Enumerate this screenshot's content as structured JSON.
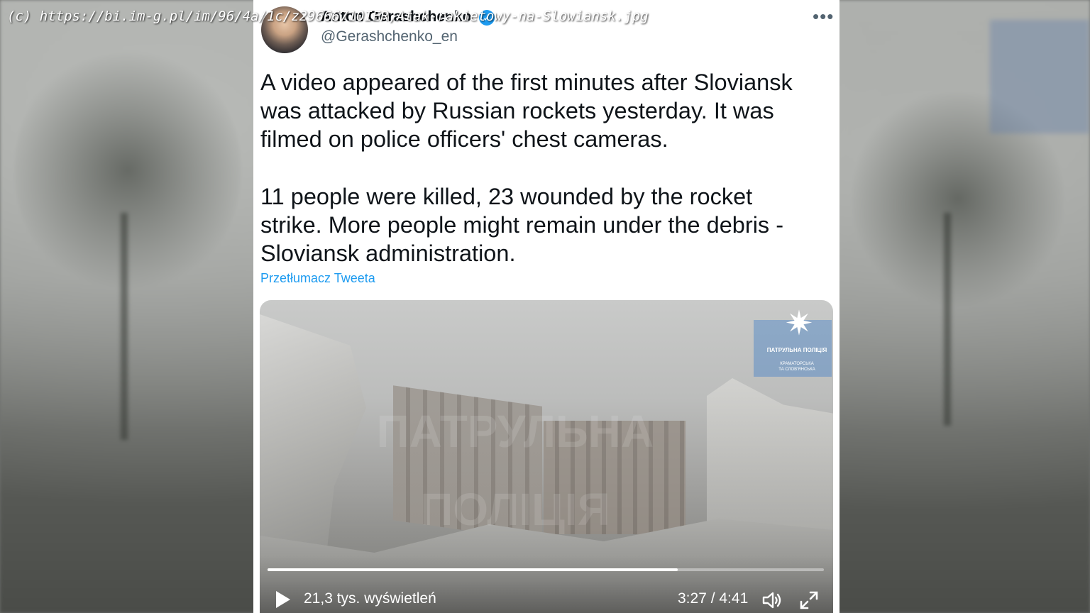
{
  "source_caption": "(c) https://bi.im-g.pl/im/96/4a/1c/z29666710IER,Atak-rakietowy-na-Slowiansk.jpg",
  "tweet": {
    "author_name": "Anton Gerashchenko",
    "verified_icon": "verified-badge-icon",
    "handle": "@Gerashchenko_en",
    "more_icon": "more-horizontal-icon",
    "paragraphs": [
      "A video appeared of the first minutes after Sloviansk\nwas attacked by Russian rockets yesterday. It was\nfilmed on police officers' chest cameras.",
      "11 people were killed, 23 wounded by the rocket\nstrike. More people might remain under the debris -\nSloviansk administration."
    ],
    "translate_link": "Przetłumacz Tweeta"
  },
  "video": {
    "watermark_line1": "ПАТРУЛЬНА",
    "watermark_line2": "ПОЛІЦІЯ",
    "badge_title": "ПАТРУЛЬНА ПОЛІЦІЯ",
    "badge_subtitle_line1": "КРАМАТОРСЬКА",
    "badge_subtitle_line2": "ТА СЛОВ'ЯНСЬКА",
    "views": "21,3 tys. wyświetleń",
    "time": "3:27 / 4:41",
    "progress": 0.737,
    "play_icon": "play-icon",
    "volume_icon": "volume-icon",
    "fullscreen_icon": "fullscreen-icon"
  },
  "colors": {
    "link": "#1d9bf0",
    "text": "#0f1419",
    "secondary": "#536471"
  }
}
